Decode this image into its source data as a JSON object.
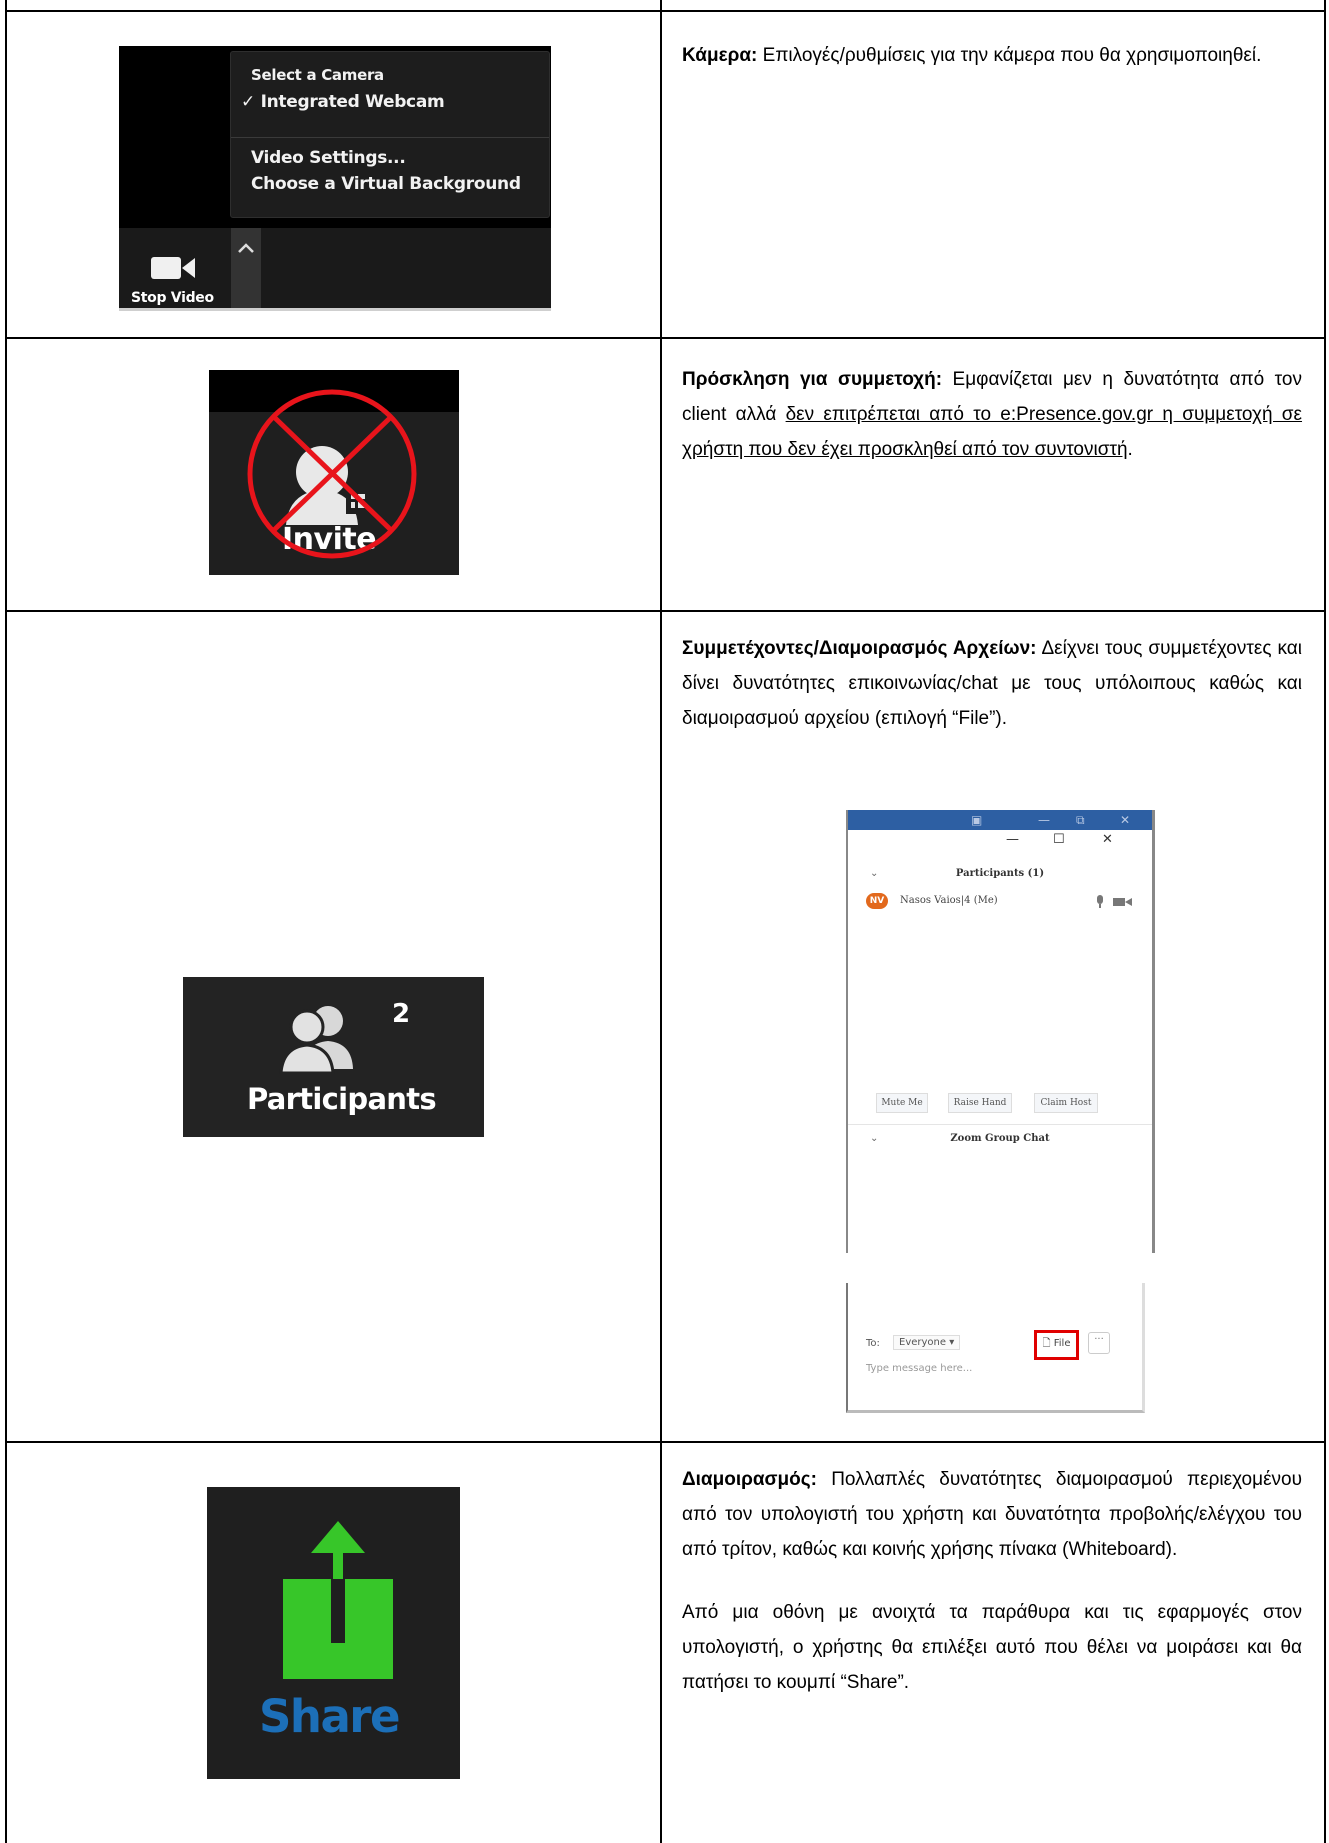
{
  "rows": [
    {
      "title": "Κάμερα:",
      "text": " Επιλογές/ρυθμίσεις για την κάμερα που θα χρησιμοποιηθεί.",
      "camera_menu": {
        "header": "Select a Camera",
        "checked": "✓ Integrated Webcam",
        "video_settings": "Video Settings...",
        "virtual_bg": "Choose a Virtual Background",
        "stop_video": "Stop Video"
      }
    },
    {
      "title": "Πρόσκληση για συμμετοχή:",
      "text": " Εμφανίζεται μεν η δυνατότητα από τον client αλλά ",
      "underlined": "δεν επιτρέπεται από το e:Presence.gov.gr η συμμετοχή σε χρήστη που δεν έχει προσκληθεί από τον συντονιστή",
      "tail": ".",
      "invite_label": "Invite"
    },
    {
      "title": "Συμμετέχοντες/Διαμοιρασμός Αρχείων:",
      "text": " Δείχνει τους συμμετέχοντες και δίνει δυνατότητες επικοινωνίας/chat με τους υπόλοιπους καθώς και διαμοιρασμού αρχείου (επιλογή “File”).",
      "participants_count": "2",
      "participants_label": "Participants",
      "panel": {
        "header": "Participants (1)",
        "avatar": "NV",
        "name": "Nasos Vaios|4 (Me)",
        "mute": "Mute Me",
        "raise": "Raise Hand",
        "claim": "Claim Host",
        "group_chat": "Zoom Group Chat",
        "to": "To:",
        "everyone": "Everyone ▾",
        "file": "File",
        "placeholder": "Type message here...",
        "more": "···"
      }
    },
    {
      "title": "Διαμοιρασμός:",
      "text": " Πολλαπλές δυνατότητες διαμοιρασμού περιεχομένου από τον υπολογιστή του χρήστη και δυνατότητα προβολής/ελέγχου του από τρίτον, καθώς και κοινής χρήσης πίνακα (Whiteboard).",
      "text2": "Από μια οθόνη με ανοιχτά τα παράθυρα και τις εφαρμογές στον υπολογιστή, ο χρήστης θα επιλέξει αυτό που θέλει να μοιράσει και θα πατήσει το κουμπί “Share”.",
      "share_label": "Share"
    }
  ],
  "colors": {
    "share_green": "#37c629",
    "share_blue": "#1c6fb8",
    "invite_red": "#e8141b",
    "file_highlight": "#e00000"
  }
}
